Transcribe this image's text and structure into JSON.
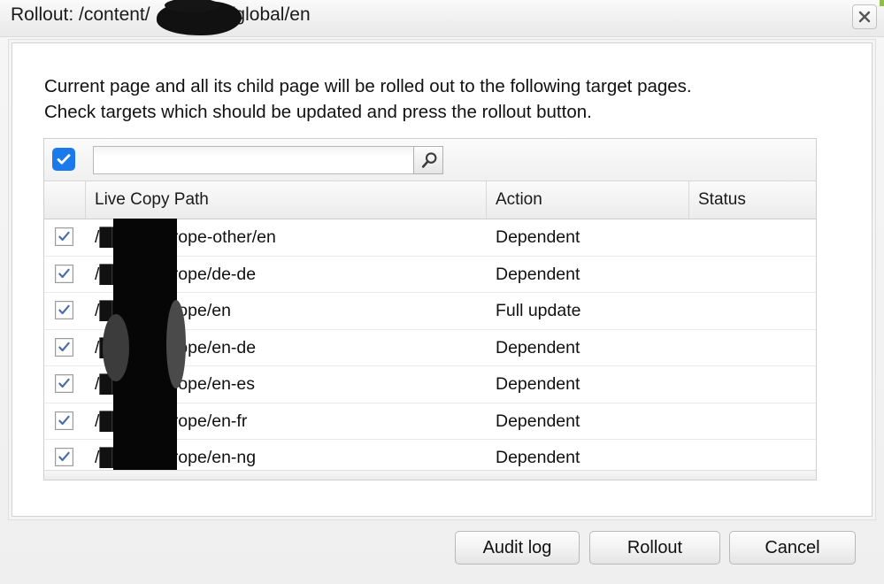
{
  "dialog": {
    "title": "Rollout: /content/█████/global/en",
    "title_prefix": "Rollout: /content/",
    "title_suffix": "/global/en",
    "close_icon": "close-icon"
  },
  "intro": {
    "line1": "Current page and all its child page will be rolled out to the following target pages.",
    "line2": "Check targets which should be updated and press the rollout button."
  },
  "toolbar": {
    "select_all_checked": "✓",
    "search_value": "",
    "search_placeholder": "",
    "search_icon": "search-icon"
  },
  "table": {
    "columns": [
      "",
      "Live Copy Path",
      "Action",
      "Status"
    ],
    "rows": [
      {
        "checked": "✓",
        "path": "/████/europe-other/en",
        "path_suffix": "/europe-other/en",
        "action": "Dependent",
        "status": ""
      },
      {
        "checked": "✓",
        "path": "/████/europe/de-de",
        "path_suffix": "/europe/de-de",
        "action": "Dependent",
        "status": ""
      },
      {
        "checked": "✓",
        "path": "/████/europe/en",
        "path_suffix": "/europe/en",
        "action": "Full update",
        "status": ""
      },
      {
        "checked": "✓",
        "path": "/████/europe/en-de",
        "path_suffix": "/europe/en-de",
        "action": "Dependent",
        "status": ""
      },
      {
        "checked": "✓",
        "path": "/████/europe/en-es",
        "path_suffix": "/europe/en-es",
        "action": "Dependent",
        "status": ""
      },
      {
        "checked": "✓",
        "path": "/████/europe/en-fr",
        "path_suffix": "/europe/en-fr",
        "action": "Dependent",
        "status": ""
      },
      {
        "checked": "✓",
        "path": "/████/europe/en-ng",
        "path_suffix": "/europe/en-ng",
        "action": "Dependent",
        "status": ""
      }
    ]
  },
  "footer": {
    "audit_log_label": "Audit log",
    "rollout_label": "Rollout",
    "cancel_label": "Cancel"
  },
  "colors": {
    "accent_blue": "#1a7aeb",
    "check_blue": "#4a6fa8",
    "corner_green": "#8fbf45",
    "redaction": "#060606"
  }
}
